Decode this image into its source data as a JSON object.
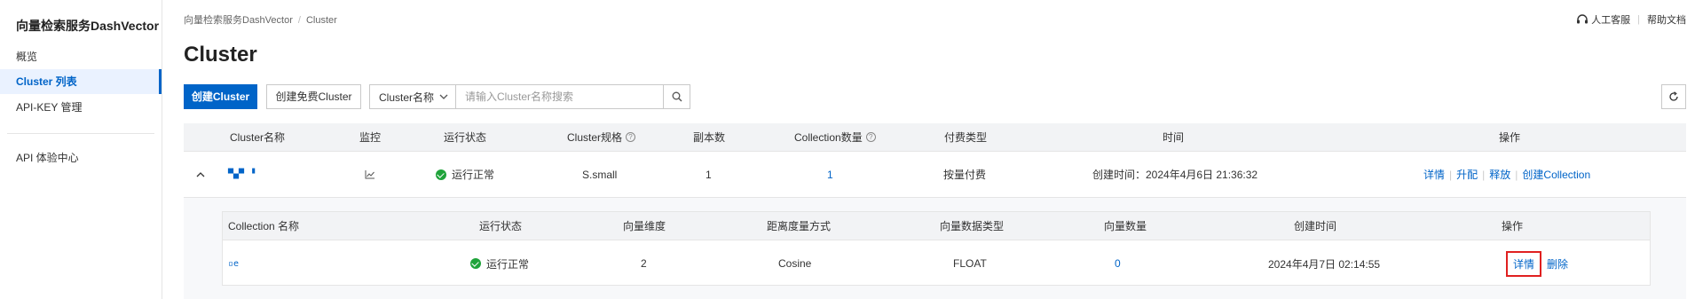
{
  "sidebar": {
    "brand": "向量检索服务DashVector",
    "items": [
      {
        "label": "概览"
      },
      {
        "label": "Cluster 列表"
      },
      {
        "label": "API-KEY 管理"
      },
      {
        "label": "API 体验中心"
      }
    ]
  },
  "breadcrumb": [
    "向量检索服务DashVector",
    "Cluster"
  ],
  "topbar": {
    "support": "人工客服",
    "docs": "帮助文档"
  },
  "page": {
    "title": "Cluster"
  },
  "toolbar": {
    "create_label": "创建Cluster",
    "create_free_label": "创建免费Cluster",
    "search_field": "Cluster名称",
    "search_placeholder": "请输入Cluster名称搜索"
  },
  "table": {
    "headers": [
      "Cluster名称",
      "监控",
      "运行状态",
      "Cluster规格",
      "副本数",
      "Collection数量",
      "付费类型",
      "时间",
      "操作"
    ],
    "rows": [
      {
        "name": "▀▄▀ ▝",
        "status": "运行正常",
        "spec": "S.small",
        "replicas": "1",
        "collections": "1",
        "billing": "按量付费",
        "time": "创建时间：2024年4月6日 21:36:32",
        "ops": [
          "详情",
          "升配",
          "释放",
          "创建Collection"
        ]
      }
    ]
  },
  "sub_table": {
    "headers": [
      "Collection 名称",
      "运行状态",
      "向量维度",
      "距离度量方式",
      "向量数据类型",
      "向量数量",
      "创建时间",
      "操作"
    ],
    "rows": [
      {
        "name": "▫e",
        "status": "运行正常",
        "dimension": "2",
        "metric": "Cosine",
        "dtype": "FLOAT",
        "count": "0",
        "created": "2024年4月7日 02:14:55",
        "ops": [
          "详情",
          "删除"
        ]
      }
    ]
  },
  "colors": {
    "primary": "#0064c8",
    "success": "#1fa33a",
    "highlight": "#e02020"
  }
}
